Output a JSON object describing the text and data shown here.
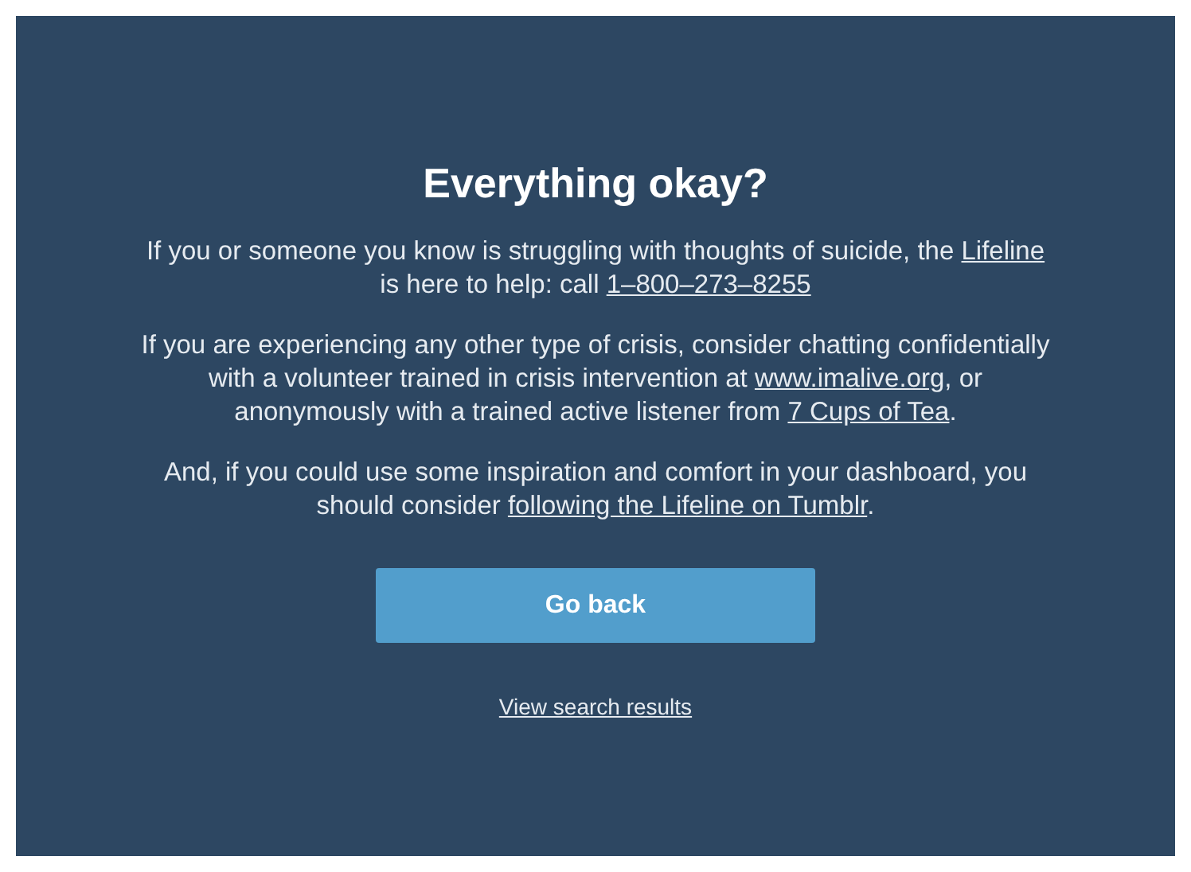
{
  "title": "Everything okay?",
  "paragraphs": [
    {
      "lines": [
        [
          {
            "text": "If you or someone you know is struggling with thoughts of suicide, the ",
            "link": false
          },
          {
            "text": "Lifeline",
            "link": true
          }
        ],
        [
          {
            "text": "is here to help: call ",
            "link": false
          },
          {
            "text": "1–800–273–8255",
            "link": true
          }
        ]
      ]
    },
    {
      "lines": [
        [
          {
            "text": "If you are experiencing any other type of crisis, consider chatting confidentially",
            "link": false
          }
        ],
        [
          {
            "text": "with a volunteer trained in crisis intervention at ",
            "link": false
          },
          {
            "text": "www.imalive.org",
            "link": true
          },
          {
            "text": ", or",
            "link": false
          }
        ],
        [
          {
            "text": "anonymously with a trained active listener from ",
            "link": false
          },
          {
            "text": "7 Cups of Tea",
            "link": true
          },
          {
            "text": ".",
            "link": false
          }
        ]
      ]
    },
    {
      "lines": [
        [
          {
            "text": "And, if you could use some inspiration and comfort in your dashboard, you",
            "link": false
          }
        ],
        [
          {
            "text": "should consider ",
            "link": false
          },
          {
            "text": "following the Lifeline on Tumblr",
            "link": true
          },
          {
            "text": ".",
            "link": false
          }
        ]
      ]
    }
  ],
  "primary_button": "Go back",
  "secondary_link": "View search results"
}
